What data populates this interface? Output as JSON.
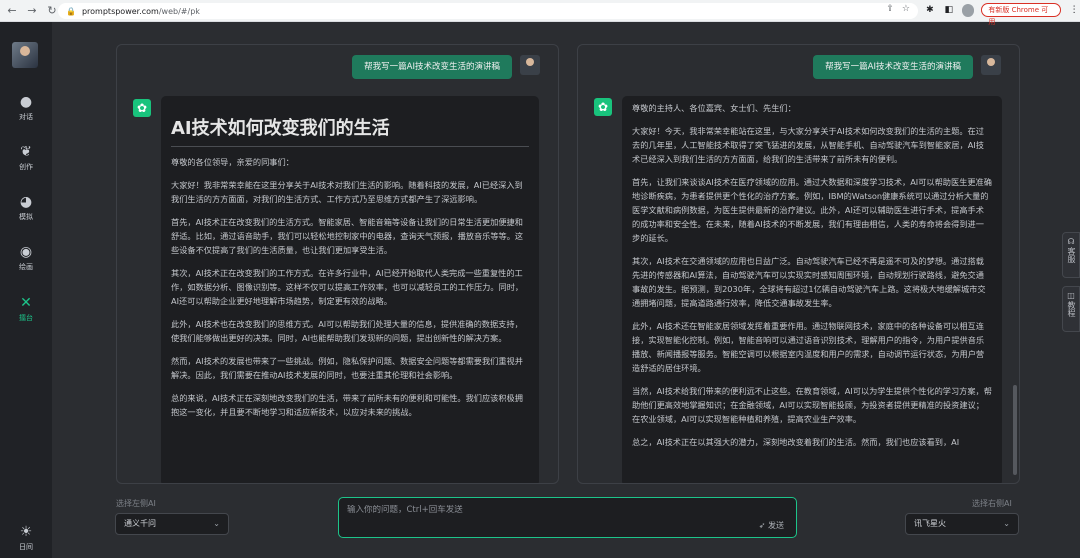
{
  "browser": {
    "url_host": "promptspower.com",
    "url_path": "/web/#/pk",
    "update_label": "有新版 Chrome 可用"
  },
  "sidebar": {
    "items": [
      {
        "label": "对话",
        "icon": "chat-icon"
      },
      {
        "label": "创作",
        "icon": "feather-icon"
      },
      {
        "label": "模拟",
        "icon": "simulate-icon"
      },
      {
        "label": "绘画",
        "icon": "palette-icon"
      },
      {
        "label": "擂台",
        "icon": "arena-icon"
      },
      {
        "label": "日间",
        "icon": "sun-icon"
      }
    ]
  },
  "left_panel": {
    "user_message": "帮我写一篇AI技术改变生活的演讲稿",
    "title": "AI技术如何改变我们的生活",
    "paragraphs": [
      "尊敬的各位领导，亲爱的同事们：",
      "大家好！我非常荣幸能在这里分享关于AI技术对我们生活的影响。随着科技的发展，AI已经深入到我们生活的方方面面，对我们的生活方式、工作方式乃至思维方式都产生了深远影响。",
      "首先，AI技术正在改变我们的生活方式。智能家居、智能音箱等设备让我们的日常生活更加便捷和舒适。比如，通过语音助手，我们可以轻松地控制家中的电器，查询天气预报，播放音乐等等。这些设备不仅提高了我们的生活质量，也让我们更加享受生活。",
      "其次，AI技术正在改变我们的工作方式。在许多行业中，AI已经开始取代人类完成一些重复性的工作，如数据分析、图像识别等。这样不仅可以提高工作效率，也可以减轻员工的工作压力。同时，AI还可以帮助企业更好地理解市场趋势，制定更有效的战略。",
      "此外，AI技术也在改变我们的思维方式。AI可以帮助我们处理大量的信息，提供准确的数据支持，使我们能够做出更好的决策。同时，AI也能帮助我们发现新的问题，提出创新性的解决方案。",
      "然而，AI技术的发展也带来了一些挑战。例如，隐私保护问题、数据安全问题等都需要我们重视并解决。因此，我们需要在推动AI技术发展的同时，也要注重其伦理和社会影响。",
      "总的来说，AI技术正在深刻地改变我们的生活，带来了前所未有的便利和可能性。我们应该积极拥抱这一变化，并且要不断地学习和适应新技术，以应对未来的挑战。"
    ]
  },
  "right_panel": {
    "user_message": "帮我写一篇AI技术改变生活的演讲稿",
    "paragraphs": [
      "尊敬的主持人、各位嘉宾、女士们、先生们：",
      "大家好！今天，我非常荣幸能站在这里，与大家分享关于AI技术如何改变我们的生活的主题。在过去的几年里，人工智能技术取得了突飞猛进的发展，从智能手机、自动驾驶汽车到智能家居，AI技术已经深入到我们生活的方方面面，给我们的生活带来了前所未有的便利。",
      "首先，让我们来谈谈AI技术在医疗领域的应用。通过大数据和深度学习技术，AI可以帮助医生更准确地诊断疾病，为患者提供更个性化的治疗方案。例如，IBM的Watson健康系统可以通过分析大量的医学文献和病例数据，为医生提供最新的治疗建议。此外，AI还可以辅助医生进行手术，提高手术的成功率和安全性。在未来，随着AI技术的不断发展，我们有理由相信，人类的寿命将会得到进一步的延长。",
      "其次，AI技术在交通领域的应用也日益广泛。自动驾驶汽车已经不再是遥不可及的梦想。通过搭载先进的传感器和AI算法，自动驾驶汽车可以实现实时感知周围环境，自动规划行驶路线，避免交通事故的发生。据预测，到2030年，全球将有超过1亿辆自动驾驶汽车上路。这将极大地缓解城市交通拥堵问题，提高道路通行效率，降低交通事故发生率。",
      "此外，AI技术还在智能家居领域发挥着重要作用。通过物联网技术，家庭中的各种设备可以相互连接，实现智能化控制。例如，智能音响可以通过语音识别技术，理解用户的指令，为用户提供音乐播放、新闻播报等服务。智能空调可以根据室内温度和用户的需求，自动调节运行状态，为用户营造舒适的居住环境。",
      "当然，AI技术给我们带来的便利远不止这些。在教育领域，AI可以为学生提供个性化的学习方案，帮助他们更高效地掌握知识；在金融领域，AI可以实现智能投顾，为投资者提供更精准的投资建议；在农业领域，AI可以实现智能种植和养殖，提高农业生产效率。",
      "总之，AI技术正在以其强大的潜力，深刻地改变着我们的生活。然而，我们也应该看到，AI"
    ]
  },
  "bottom": {
    "left_label": "选择左侧AI",
    "left_value": "通义千问",
    "right_label": "选择右侧AI",
    "right_value": "讯飞星火",
    "input_placeholder": "输入你的问题，Ctrl+回车发送",
    "send_label": "发送"
  },
  "side_tabs": {
    "service": "客服",
    "tutorial": "教程"
  }
}
